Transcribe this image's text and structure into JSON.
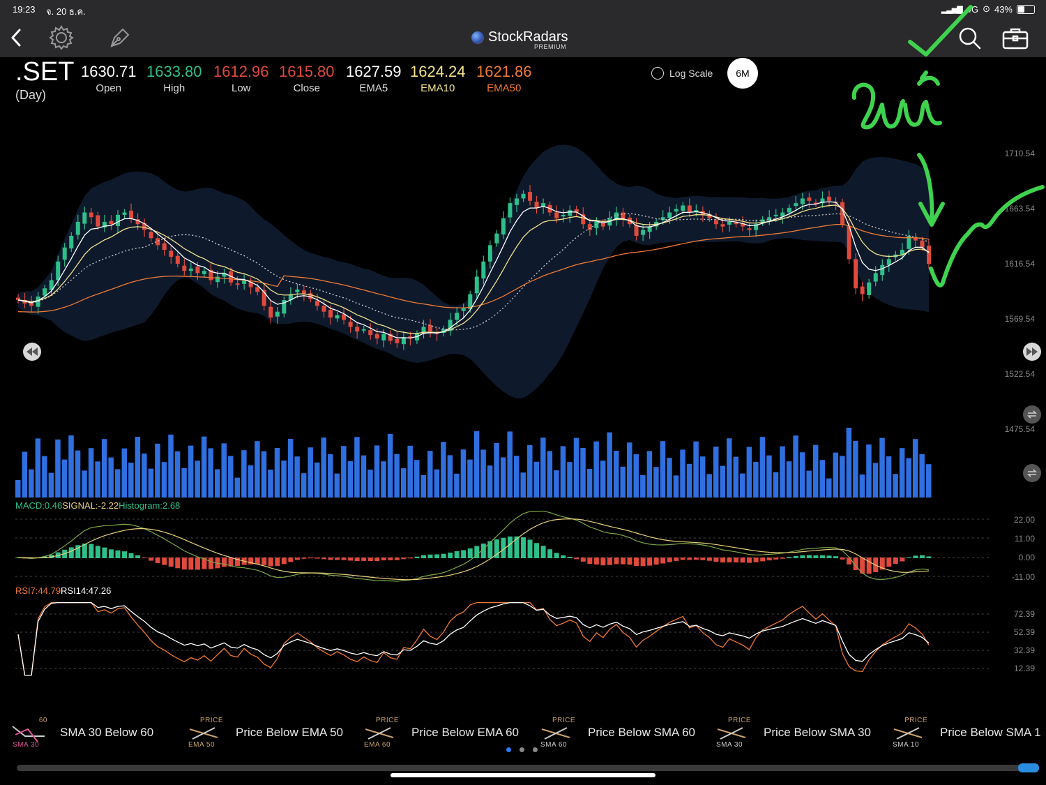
{
  "status": {
    "time": "19:23",
    "date": "จ. 20 ธ.ค.",
    "network": "4G",
    "battery": "43%",
    "battery_level": 0.43
  },
  "nav": {
    "app_name": "StockRadars",
    "tier": "PREMIUM"
  },
  "quote": {
    "symbol": ".SET",
    "period": "(Day)",
    "fields": [
      {
        "value": "1630.71",
        "label": "Open",
        "color": "#ffffff"
      },
      {
        "value": "1633.80",
        "label": "High",
        "color": "#2fbf8a"
      },
      {
        "value": "1612.96",
        "label": "Low",
        "color": "#e04a3c"
      },
      {
        "value": "1615.80",
        "label": "Close",
        "color": "#e04a3c"
      },
      {
        "value": "1627.59",
        "label": "EMA5",
        "color": "#ffffff"
      },
      {
        "value": "1624.24",
        "label": "EMA10",
        "color": "#f3e28a"
      },
      {
        "value": "1621.86",
        "label": "EMA50",
        "color": "#f07a33"
      }
    ],
    "log_scale_label": "Log Scale",
    "timeframe": "6M"
  },
  "annotation": {
    "text": "วันนี้",
    "color": "#3fd24f"
  },
  "price_axis": [
    "1710.54",
    "1663.54",
    "1616.54",
    "1569.54",
    "1522.54",
    "1475.54"
  ],
  "macd": {
    "macd_label": "MACD:0.46",
    "signal_label": "SIGNAL:-2.22",
    "histogram_label": "Histogram:2.68",
    "axis": [
      "22.00",
      "11.00",
      "0.00",
      "-11.00"
    ]
  },
  "rsi": {
    "rsi7_label": "RSI7:44.79",
    "rsi14_label": "RSI14:47.26",
    "axis": [
      "72.39",
      "52.39",
      "32.39",
      "12.39"
    ]
  },
  "alerts": [
    {
      "top": "60",
      "bottom": "SMA   30",
      "text": "SMA 30 Below 60"
    },
    {
      "top": "PRICE",
      "bottom": "EMA   50",
      "text": "Price Below EMA 50"
    },
    {
      "top": "PRICE",
      "bottom": "EMA   60",
      "text": "Price Below EMA 60"
    },
    {
      "top": "PRICE",
      "bottom": "SMA   60",
      "text": "Price Below SMA 60"
    },
    {
      "top": "PRICE",
      "bottom": "SMA   30",
      "text": "Price Below SMA 30"
    },
    {
      "top": "PRICE",
      "bottom": "SMA   10",
      "text": "Price Below SMA 1"
    }
  ],
  "colors": {
    "up": "#2fbf8a",
    "down": "#e04a3c",
    "volume": "#2f6fe0",
    "band": "#0e1a2c",
    "ema5": "#ffffff",
    "ema10": "#f3e28a",
    "ema50": "#f07a33",
    "macd_line": "#7fa84a",
    "signal_line": "#e8d27a",
    "rsi7": "#f07a33",
    "rsi14": "#ffffff"
  },
  "chart_data": {
    "type": "candlestick",
    "ylim": [
      1475.54,
      1710.54
    ],
    "closes": [
      1585,
      1582,
      1580,
      1588,
      1595,
      1602,
      1618,
      1630,
      1640,
      1652,
      1660,
      1656,
      1648,
      1652,
      1650,
      1658,
      1660,
      1655,
      1650,
      1645,
      1638,
      1632,
      1628,
      1622,
      1616,
      1610,
      1612,
      1608,
      1610,
      1602,
      1605,
      1608,
      1600,
      1598,
      1602,
      1596,
      1592,
      1580,
      1570,
      1575,
      1585,
      1590,
      1594,
      1590,
      1586,
      1580,
      1575,
      1570,
      1572,
      1568,
      1562,
      1558,
      1560,
      1555,
      1552,
      1556,
      1550,
      1548,
      1553,
      1552,
      1556,
      1562,
      1558,
      1556,
      1560,
      1568,
      1574,
      1578,
      1590,
      1605,
      1618,
      1632,
      1642,
      1655,
      1668,
      1672,
      1676,
      1670,
      1664,
      1668,
      1660,
      1655,
      1658,
      1662,
      1660,
      1650,
      1645,
      1652,
      1648,
      1655,
      1660,
      1654,
      1650,
      1640,
      1645,
      1648,
      1652,
      1656,
      1660,
      1663,
      1666,
      1660,
      1662,
      1658,
      1655,
      1650,
      1648,
      1652,
      1650,
      1648,
      1645,
      1650,
      1654,
      1656,
      1658,
      1660,
      1664,
      1668,
      1672,
      1670,
      1668,
      1672,
      1670,
      1668,
      1650,
      1620,
      1595,
      1590,
      1600,
      1608,
      1615,
      1620,
      1624,
      1628,
      1640,
      1636,
      1630,
      1616
    ],
    "volume_note": "relative volume bars",
    "indicators": [
      "EMA5",
      "EMA10",
      "EMA50",
      "Bollinger Bands",
      "Volume",
      "MACD",
      "RSI7",
      "RSI14"
    ]
  }
}
